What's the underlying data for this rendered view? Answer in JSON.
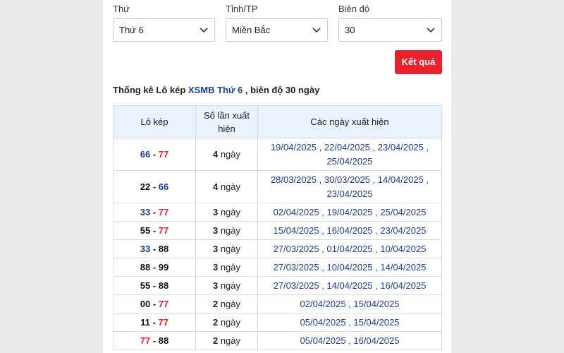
{
  "filters": {
    "day": {
      "label": "Thứ",
      "value": "Thứ 6"
    },
    "province": {
      "label": "Tỉnh/TP",
      "value": "Miền Bắc"
    },
    "range": {
      "label": "Biên độ",
      "value": "30"
    }
  },
  "result_button": "Kết quả",
  "heading": {
    "prefix": "Thống kê Lô kép",
    "link": "XSMB Thứ 6",
    "suffix": ", biên độ 30 ngày"
  },
  "table": {
    "headers": [
      "Lô kép",
      "Số lần xuất hiện",
      "Các ngày xuất hiện"
    ],
    "rows": [
      {
        "a": "66",
        "a_color": "blue",
        "b": "77",
        "b_color": "red",
        "count": "4",
        "unit": "ngày",
        "dates": "19/04/2025 , 22/04/2025 , 23/04/2025 , 25/04/2025"
      },
      {
        "a": "22",
        "a_color": "normal",
        "b": "66",
        "b_color": "blue",
        "count": "4",
        "unit": "ngày",
        "dates": "28/03/2025 , 30/03/2025 , 14/04/2025 , 23/04/2025"
      },
      {
        "a": "33",
        "a_color": "blue",
        "b": "77",
        "b_color": "red",
        "count": "3",
        "unit": "ngày",
        "dates": "02/04/2025 , 19/04/2025 , 25/04/2025"
      },
      {
        "a": "55",
        "a_color": "normal",
        "b": "77",
        "b_color": "red",
        "count": "3",
        "unit": "ngày",
        "dates": "15/04/2025 , 16/04/2025 , 23/04/2025"
      },
      {
        "a": "33",
        "a_color": "blue",
        "b": "88",
        "b_color": "normal",
        "count": "3",
        "unit": "ngày",
        "dates": "27/03/2025 , 01/04/2025 , 10/04/2025"
      },
      {
        "a": "88",
        "a_color": "normal",
        "b": "99",
        "b_color": "normal",
        "count": "3",
        "unit": "ngày",
        "dates": "27/03/2025 , 10/04/2025 , 14/04/2025"
      },
      {
        "a": "55",
        "a_color": "normal",
        "b": "88",
        "b_color": "normal",
        "count": "3",
        "unit": "ngày",
        "dates": "27/03/2025 , 14/04/2025 , 16/04/2025"
      },
      {
        "a": "00",
        "a_color": "normal",
        "b": "77",
        "b_color": "red",
        "count": "2",
        "unit": "ngày",
        "dates": "02/04/2025 , 15/04/2025"
      },
      {
        "a": "11",
        "a_color": "normal",
        "b": "77",
        "b_color": "red",
        "count": "2",
        "unit": "ngày",
        "dates": "05/04/2025 , 15/04/2025"
      },
      {
        "a": "77",
        "a_color": "red",
        "b": "88",
        "b_color": "normal",
        "count": "2",
        "unit": "ngày",
        "dates": "05/04/2025 , 16/04/2025"
      }
    ]
  },
  "colors": {
    "accent_red": "#e8212c",
    "link_blue": "#1a3d9e",
    "header_bg": "#e9f3fd"
  }
}
